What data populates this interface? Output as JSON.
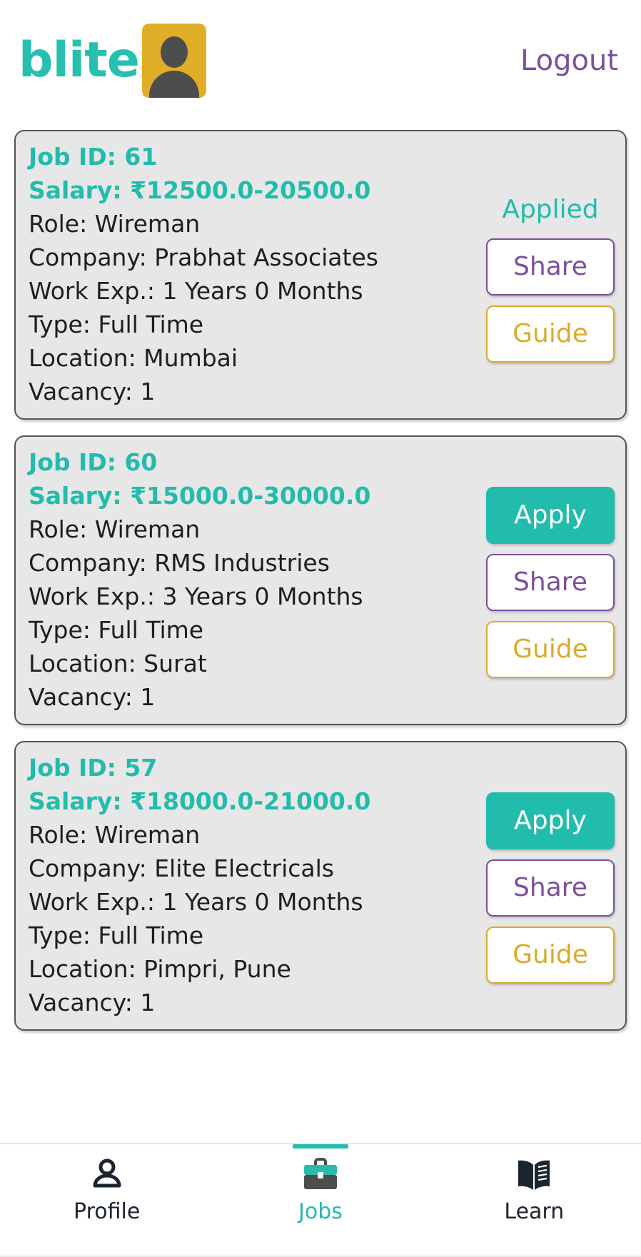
{
  "header": {
    "brand_name": "blite",
    "avatar_icon": "person-avatar-icon",
    "logout_label": "Logout"
  },
  "colors": {
    "teal": "#22BCAC",
    "purple": "#7B4F9D",
    "gold": "#D9AB2D",
    "avatar_bg": "#E0AE27",
    "card_bg": "#E7E7E7",
    "card_border": "#555555",
    "text": "#1E1E1E"
  },
  "labels": {
    "apply": "Apply",
    "share": "Share",
    "guide": "Guide",
    "applied": "Applied"
  },
  "jobs": [
    {
      "job_id_line": "Job ID: 61",
      "salary_line": "Salary: ₹12500.0-20500.0",
      "role_line": "Role: Wireman",
      "company_line": "Company: Prabhat Associates",
      "work_exp_line": "Work Exp.: 1 Years 0 Months",
      "type_line": "Type: Full Time",
      "location_line": "Location: Mumbai",
      "vacancy_line": "Vacancy: 1",
      "applied": true,
      "status_label": "Applied"
    },
    {
      "job_id_line": "Job ID: 60",
      "salary_line": "Salary: ₹15000.0-30000.0",
      "role_line": "Role: Wireman",
      "company_line": "Company: RMS Industries",
      "work_exp_line": "Work Exp.: 3 Years 0 Months",
      "type_line": "Type: Full Time",
      "location_line": "Location: Surat",
      "vacancy_line": "Vacancy: 1",
      "applied": false,
      "status_label": ""
    },
    {
      "job_id_line": "Job ID: 57",
      "salary_line": "Salary: ₹18000.0-21000.0",
      "role_line": "Role: Wireman",
      "company_line": "Company: Elite Electricals",
      "work_exp_line": "Work Exp.: 1 Years 0 Months",
      "type_line": "Type: Full Time",
      "location_line": "Location: Pimpri, Pune",
      "vacancy_line": "Vacancy: 1",
      "applied": false,
      "status_label": ""
    }
  ],
  "bottom_nav": {
    "items": [
      {
        "label": "Profile",
        "icon": "person-outline-icon",
        "active": false
      },
      {
        "label": "Jobs",
        "icon": "briefcase-icon",
        "active": true
      },
      {
        "label": "Learn",
        "icon": "open-book-icon",
        "active": false
      }
    ]
  }
}
